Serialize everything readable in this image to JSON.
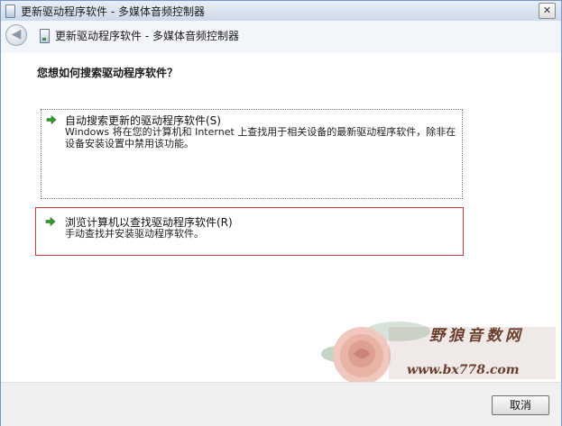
{
  "window": {
    "title": "更新驱动程序软件 - 多媒体音频控制器",
    "close_label": "✕"
  },
  "nav": {
    "back_label": "◀",
    "title": "更新驱动程序软件 - 多媒体音频控制器"
  },
  "main": {
    "question": "您想如何搜索驱动程序软件？",
    "options": [
      {
        "title": "自动搜索更新的驱动程序软件(S)",
        "description": "Windows 将在您的计算机和 Internet 上查找用于相关设备的最新驱动程序软件，除非在设备安装设置中禁用该功能。"
      },
      {
        "title": "浏览计算机以查找驱动程序软件(R)",
        "description": "手动查找并安装驱动程序软件。"
      }
    ]
  },
  "watermark": {
    "text": "野狼音数网",
    "url": "www.bx778.com"
  },
  "footer": {
    "cancel_label": "取消"
  },
  "colors": {
    "selection_border": "#d43c3c",
    "arrow_green": "#2f9a2f"
  }
}
